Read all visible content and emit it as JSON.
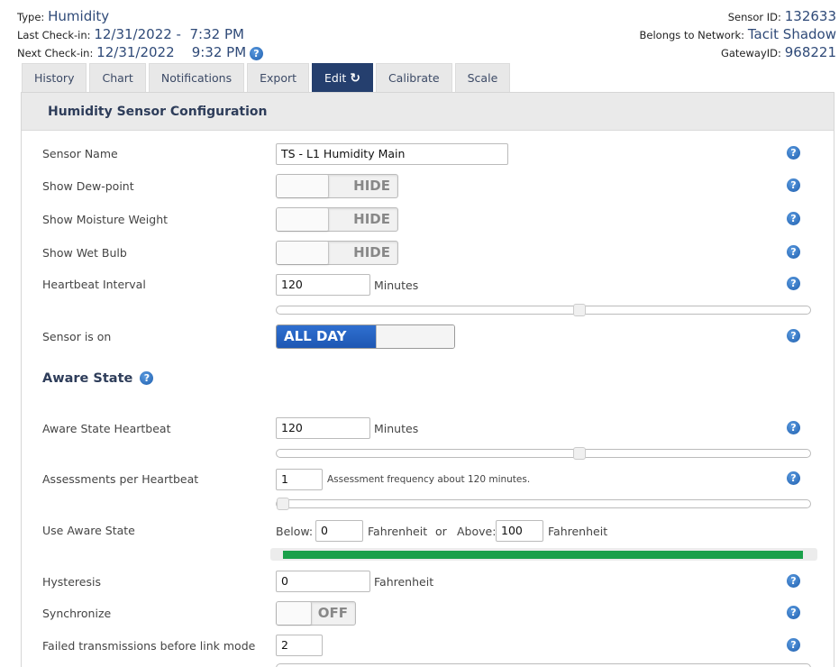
{
  "header": {
    "type_label": "Type:",
    "type_value": "Humidity",
    "last_checkin_label": "Last Check-in:",
    "last_checkin_value": "12/31/2022 -  7:32 PM",
    "next_checkin_label": "Next Check-in:",
    "next_checkin_value": "12/31/2022    9:32 PM",
    "sensor_id_label": "Sensor ID:",
    "sensor_id_value": "132633",
    "network_label": "Belongs to Network:",
    "network_value": "Tacit Shadow",
    "gateway_label": "GatewayID:",
    "gateway_value": "968221"
  },
  "tabs": [
    {
      "label": "History"
    },
    {
      "label": "Chart"
    },
    {
      "label": "Notifications"
    },
    {
      "label": "Export"
    },
    {
      "label": "Edit",
      "active": true,
      "icon": "refresh-icon"
    },
    {
      "label": "Calibrate"
    },
    {
      "label": "Scale"
    }
  ],
  "panel": {
    "title": "Humidity Sensor Configuration"
  },
  "form": {
    "sensor_name": {
      "label": "Sensor Name",
      "value": "TS - L1 Humidity Main"
    },
    "show_dewpoint": {
      "label": "Show Dew-point",
      "state": "HIDE"
    },
    "show_moisture": {
      "label": "Show Moisture Weight",
      "state": "HIDE"
    },
    "show_wetbulb": {
      "label": "Show Wet Bulb",
      "state": "HIDE"
    },
    "heartbeat": {
      "label": "Heartbeat Interval",
      "value": "120",
      "unit": "Minutes",
      "slider_fraction": 0.57
    },
    "sensor_on": {
      "label": "Sensor is on",
      "state": "ALL DAY"
    },
    "aware_section": {
      "title": "Aware State"
    },
    "aware_heartbeat": {
      "label": "Aware State Heartbeat",
      "value": "120",
      "unit": "Minutes",
      "slider_fraction": 0.57
    },
    "assessments": {
      "label": "Assessments per Heartbeat",
      "value": "1",
      "note": "Assessment frequency about 120 minutes.",
      "slider_fraction": 0.0
    },
    "use_aware": {
      "label": "Use Aware State",
      "below_label": "Below:",
      "below_value": "0",
      "below_unit": "Fahrenheit",
      "or_text": "or",
      "above_label": "Above:",
      "above_value": "100",
      "above_unit": "Fahrenheit"
    },
    "hysteresis": {
      "label": "Hysteresis",
      "value": "0",
      "unit": "Fahrenheit"
    },
    "synchronize": {
      "label": "Synchronize",
      "state": "OFF"
    },
    "failed_tx": {
      "label": "Failed transmissions before link mode",
      "value": "2"
    }
  },
  "help_icon": "?",
  "colors": {
    "accent": "#253f6e",
    "toggle_on": "#1e57b3",
    "range_fill": "#1aa04a",
    "link": "#2f4a78"
  }
}
